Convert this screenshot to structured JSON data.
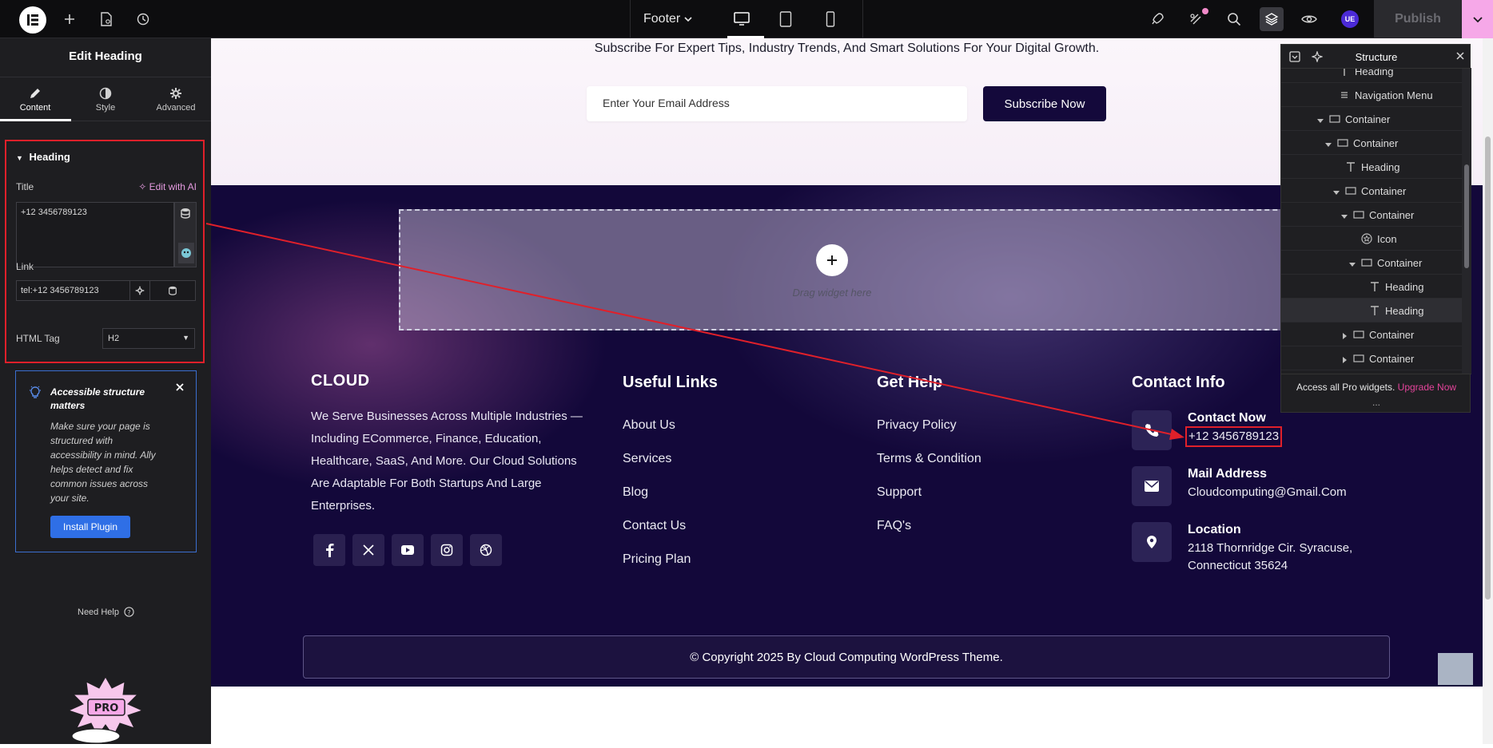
{
  "topbar": {
    "document_name": "Footer",
    "publish_label": "Publish",
    "user_badge": "UE"
  },
  "left_panel": {
    "title": "Edit Heading",
    "tabs": [
      {
        "label": "Content"
      },
      {
        "label": "Style"
      },
      {
        "label": "Advanced"
      }
    ],
    "section_title": "Heading",
    "title_label": "Title",
    "edit_with_ai": "Edit with AI",
    "title_value": "+12 3456789123",
    "link_label": "Link",
    "link_value": "tel:+12 3456789123",
    "html_tag_label": "HTML Tag",
    "html_tag_value": "H2",
    "notice": {
      "title": "Accessible structure matters",
      "body": "Make sure your page is structured with accessibility in mind. Ally helps detect and fix common issues across your site.",
      "button": "Install Plugin"
    },
    "need_help": "Need Help",
    "pro_sticker_text": "PRO"
  },
  "canvas": {
    "subscribe_text": "Subscribe For Expert Tips, Industry Trends, And Smart Solutions For Your Digital Growth.",
    "email_placeholder": "Enter Your Email Address",
    "subscribe_button": "Subscribe Now",
    "drop_zone_text": "Drag widget here",
    "brand_name": "CLOUD",
    "brand_description": "We Serve Businesses Across Multiple Industries — Including ECommerce, Finance, Education, Healthcare, SaaS, And More. Our Cloud Solutions Are Adaptable For Both Startups And Large Enterprises.",
    "useful_links_title": "Useful Links",
    "useful_links": [
      "About Us",
      "Services",
      "Blog",
      "Contact Us",
      "Pricing Plan"
    ],
    "get_help_title": "Get Help",
    "get_help_links": [
      "Privacy Policy",
      "Terms & Condition",
      "Support",
      "FAQ's"
    ],
    "contact_title": "Contact Info",
    "contact": [
      {
        "label": "Contact Now",
        "value": "+12 3456789123",
        "icon": "phone-icon"
      },
      {
        "label": "Mail Address",
        "value": "Cloudcomputing@Gmail.Com",
        "icon": "mail-icon"
      },
      {
        "label": "Location",
        "value": "2118 Thornridge Cir. Syracuse, Connecticut 35624",
        "icon": "location-pin-icon"
      }
    ],
    "social_icons": [
      "facebook-icon",
      "x-icon",
      "youtube-icon",
      "instagram-icon",
      "dribbble-icon"
    ],
    "copyright": "© Copyright 2025 By Cloud Computing WordPress Theme."
  },
  "structure": {
    "title": "Structure",
    "rows": [
      {
        "label": "Heading",
        "type": "heading"
      },
      {
        "label": "Navigation Menu",
        "type": "nav"
      },
      {
        "label": "Container",
        "type": "container"
      },
      {
        "label": "Container",
        "type": "container"
      },
      {
        "label": "Heading",
        "type": "heading"
      },
      {
        "label": "Container",
        "type": "container"
      },
      {
        "label": "Container",
        "type": "container"
      },
      {
        "label": "Icon",
        "type": "icon"
      },
      {
        "label": "Container",
        "type": "container"
      },
      {
        "label": "Heading",
        "type": "heading"
      },
      {
        "label": "Heading",
        "type": "heading"
      },
      {
        "label": "Container",
        "type": "container"
      },
      {
        "label": "Container",
        "type": "container"
      }
    ],
    "pro_text": "Access all Pro widgets.",
    "upgrade_label": "Upgrade Now",
    "more": "..."
  },
  "colors": {
    "accent": "#e0202a",
    "footer_bg": "#13083a",
    "subscribe_btn": "#14093b",
    "upgrade": "#e3449a"
  }
}
